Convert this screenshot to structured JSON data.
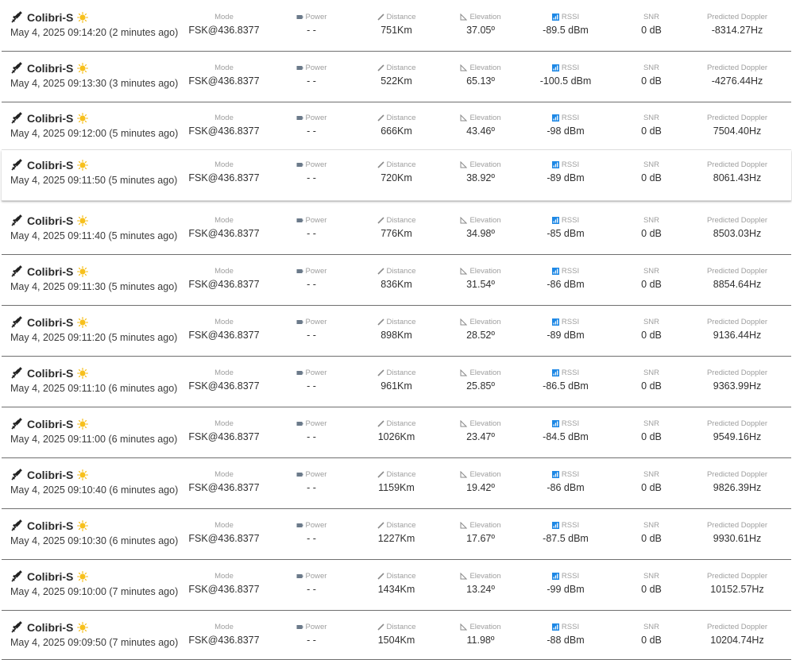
{
  "labels": {
    "mode": "Mode",
    "power": "Power",
    "distance": "Distance",
    "elevation": "Elevation",
    "rssi": "RSSI",
    "snr": "SNR",
    "doppler": "Predicted Doppler"
  },
  "icons": {
    "satellite": "satellite-icon",
    "sun": "sun-icon",
    "power": "battery-icon",
    "distance": "ruler-icon",
    "elevation": "angle-icon",
    "rssi": "signal-bars-icon"
  },
  "colors": {
    "sun": "#f7c01d",
    "rssi_icon": "#1e88e5",
    "row_divider": "#6f6f6f"
  },
  "packets": [
    {
      "satellite": "Colibri-S",
      "time": "May 4, 2025 09:14:20 (2 minutes ago)",
      "mode": "FSK@436.8377",
      "power": "- -",
      "distance": "751Km",
      "elevation": "37.05º",
      "rssi": "-89.5 dBm",
      "snr": "0 dB",
      "doppler": "-8314.27Hz"
    },
    {
      "satellite": "Colibri-S",
      "time": "May 4, 2025 09:13:30 (3 minutes ago)",
      "mode": "FSK@436.8377",
      "power": "- -",
      "distance": "522Km",
      "elevation": "65.13º",
      "rssi": "-100.5 dBm",
      "snr": "0 dB",
      "doppler": "-4276.44Hz"
    },
    {
      "satellite": "Colibri-S",
      "time": "May 4, 2025 09:12:00 (5 minutes ago)",
      "mode": "FSK@436.8377",
      "power": "- -",
      "distance": "666Km",
      "elevation": "43.46º",
      "rssi": "-98 dBm",
      "snr": "0 dB",
      "doppler": "7504.40Hz"
    },
    {
      "satellite": "Colibri-S",
      "time": "May 4, 2025 09:11:50 (5 minutes ago)",
      "mode": "FSK@436.8377",
      "power": "- -",
      "distance": "720Km",
      "elevation": "38.92º",
      "rssi": "-89 dBm",
      "snr": "0 dB",
      "doppler": "8061.43Hz"
    },
    {
      "satellite": "Colibri-S",
      "time": "May 4, 2025 09:11:40 (5 minutes ago)",
      "mode": "FSK@436.8377",
      "power": "- -",
      "distance": "776Km",
      "elevation": "34.98º",
      "rssi": "-85 dBm",
      "snr": "0 dB",
      "doppler": "8503.03Hz"
    },
    {
      "satellite": "Colibri-S",
      "time": "May 4, 2025 09:11:30 (5 minutes ago)",
      "mode": "FSK@436.8377",
      "power": "- -",
      "distance": "836Km",
      "elevation": "31.54º",
      "rssi": "-86 dBm",
      "snr": "0 dB",
      "doppler": "8854.64Hz"
    },
    {
      "satellite": "Colibri-S",
      "time": "May 4, 2025 09:11:20 (5 minutes ago)",
      "mode": "FSK@436.8377",
      "power": "- -",
      "distance": "898Km",
      "elevation": "28.52º",
      "rssi": "-89 dBm",
      "snr": "0 dB",
      "doppler": "9136.44Hz"
    },
    {
      "satellite": "Colibri-S",
      "time": "May 4, 2025 09:11:10 (6 minutes ago)",
      "mode": "FSK@436.8377",
      "power": "- -",
      "distance": "961Km",
      "elevation": "25.85º",
      "rssi": "-86.5 dBm",
      "snr": "0 dB",
      "doppler": "9363.99Hz"
    },
    {
      "satellite": "Colibri-S",
      "time": "May 4, 2025 09:11:00 (6 minutes ago)",
      "mode": "FSK@436.8377",
      "power": "- -",
      "distance": "1026Km",
      "elevation": "23.47º",
      "rssi": "-84.5 dBm",
      "snr": "0 dB",
      "doppler": "9549.16Hz"
    },
    {
      "satellite": "Colibri-S",
      "time": "May 4, 2025 09:10:40 (6 minutes ago)",
      "mode": "FSK@436.8377",
      "power": "- -",
      "distance": "1159Km",
      "elevation": "19.42º",
      "rssi": "-86 dBm",
      "snr": "0 dB",
      "doppler": "9826.39Hz"
    },
    {
      "satellite": "Colibri-S",
      "time": "May 4, 2025 09:10:30 (6 minutes ago)",
      "mode": "FSK@436.8377",
      "power": "- -",
      "distance": "1227Km",
      "elevation": "17.67º",
      "rssi": "-87.5 dBm",
      "snr": "0 dB",
      "doppler": "9930.61Hz"
    },
    {
      "satellite": "Colibri-S",
      "time": "May 4, 2025 09:10:00 (7 minutes ago)",
      "mode": "FSK@436.8377",
      "power": "- -",
      "distance": "1434Km",
      "elevation": "13.24º",
      "rssi": "-99 dBm",
      "snr": "0 dB",
      "doppler": "10152.57Hz"
    },
    {
      "satellite": "Colibri-S",
      "time": "May 4, 2025 09:09:50 (7 minutes ago)",
      "mode": "FSK@436.8377",
      "power": "- -",
      "distance": "1504Km",
      "elevation": "11.98º",
      "rssi": "-88 dBm",
      "snr": "0 dB",
      "doppler": "10204.74Hz"
    }
  ]
}
